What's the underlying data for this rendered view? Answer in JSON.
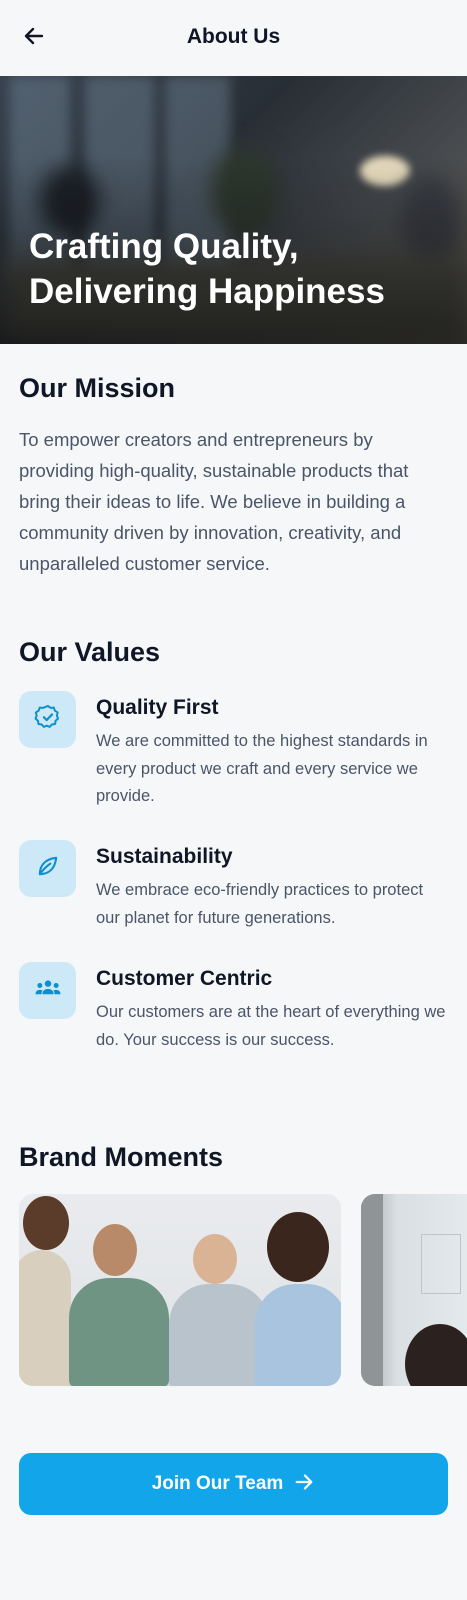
{
  "header": {
    "title": "About Us",
    "back_icon": "arrow-left-icon"
  },
  "hero": {
    "title_line1": "Crafting Quality,",
    "title_line2": "Delivering Happiness"
  },
  "mission": {
    "heading": "Our Mission",
    "text": "To empower creators and entrepreneurs by providing high-quality, sustainable products that bring their ideas to life. We believe in building a community driven by innovation, creativity, and unparalleled customer service."
  },
  "values": {
    "heading": "Our Values",
    "items": [
      {
        "icon": "verified-badge-icon",
        "title": "Quality First",
        "description": "We are committed to the highest standards in every product we craft and every service we provide."
      },
      {
        "icon": "leaf-icon",
        "title": "Sustainability",
        "description": "We embrace eco-friendly practices to protect our planet for future generations."
      },
      {
        "icon": "groups-icon",
        "title": "Customer Centric",
        "description": "Our customers are at the heart of everything we do. Your success is our success."
      }
    ]
  },
  "moments": {
    "heading": "Brand Moments"
  },
  "cta": {
    "label": "Join Our Team",
    "icon": "arrow-right-icon"
  },
  "colors": {
    "accent": "#12a5ea",
    "icon_bg": "#cde9f7",
    "text_dark": "#0f1626",
    "text_muted": "#4a5568",
    "background": "#f6f7f9"
  }
}
